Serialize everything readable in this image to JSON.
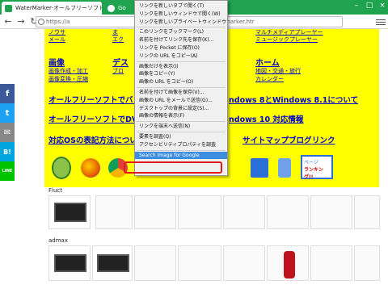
{
  "browser": {
    "tabs": [
      {
        "title": "WaterMarker-オールフリーソフト"
      },
      {
        "title": "Go"
      }
    ],
    "url_left": "https://a",
    "url_right": "ermarker.htr"
  },
  "sidebar_share": [
    "f",
    "t",
    "✉",
    "B!",
    "LINE"
  ],
  "page": {
    "top_links_left": [
      "ノウサ",
      "メール"
    ],
    "top_links_mid": [
      "ま",
      "エク"
    ],
    "top_links_right": [
      "マルチメディアプレーヤー",
      "ミュージックプレーヤー"
    ],
    "sections": {
      "image": {
        "title": "画像",
        "items": [
          "画像作成・加工",
          "画像変換・圧縮"
        ]
      },
      "design": {
        "title": "デス"
      },
      "home": {
        "title": "ホーム",
        "items": [
          "地図・交通・旅行",
          "カレンダー"
        ]
      },
      "blog": {
        "title": "ブロ"
      }
    },
    "line1_left": "オールフリーソフトでバッ",
    "line1_right": "ndows 8とWindows 8.1について",
    "line2_left": "オールフリーソフトでDVD",
    "line2_right": "ndows 10 対応情報",
    "line3_left": "対応OSの表記方法について",
    "line3_right_items": [
      "サイトマップ",
      "ブログ",
      "リンク"
    ],
    "fluct_label": "Fluct",
    "admax_label": "admax",
    "ranking_badge": [
      "ページ",
      "ランキング!!"
    ]
  },
  "context_menu": {
    "items": [
      "リンクを新しいタブで開く(T)",
      "リンクを新しいウィンドウで開く(W)",
      "リンクを新しいプライベートウィンドウで開く(P)",
      "---",
      "このリンクをブックマーク(L)",
      "名前を付けてリンク先を保存(K)...",
      "リンクを Pocket に保存(O)",
      "リンクの URL をコピー(A)",
      "---",
      "画像だけを表示(I)",
      "画像をコピー(Y)",
      "画像の URL をコピー(O)",
      "---",
      "名前を付けて画像を保存(V)...",
      "画像の URL をメールで送信(G)...",
      "デスクトップの背景に設定(S)...",
      "画像の情報を表示(F)",
      "---",
      "リンクを端末へ送信(N)",
      "---",
      "要素を調査(Q)",
      "アクセシビリティプロパティを調査",
      "---",
      "Search Image for Google"
    ],
    "highlighted": "Search Image for Google"
  },
  "colors": {
    "tabbar": "#1fa34f",
    "page_bg": "#ffff00",
    "link": "#0000cc",
    "highlight": "#3d8ee0",
    "annotation": "#e0191b"
  }
}
